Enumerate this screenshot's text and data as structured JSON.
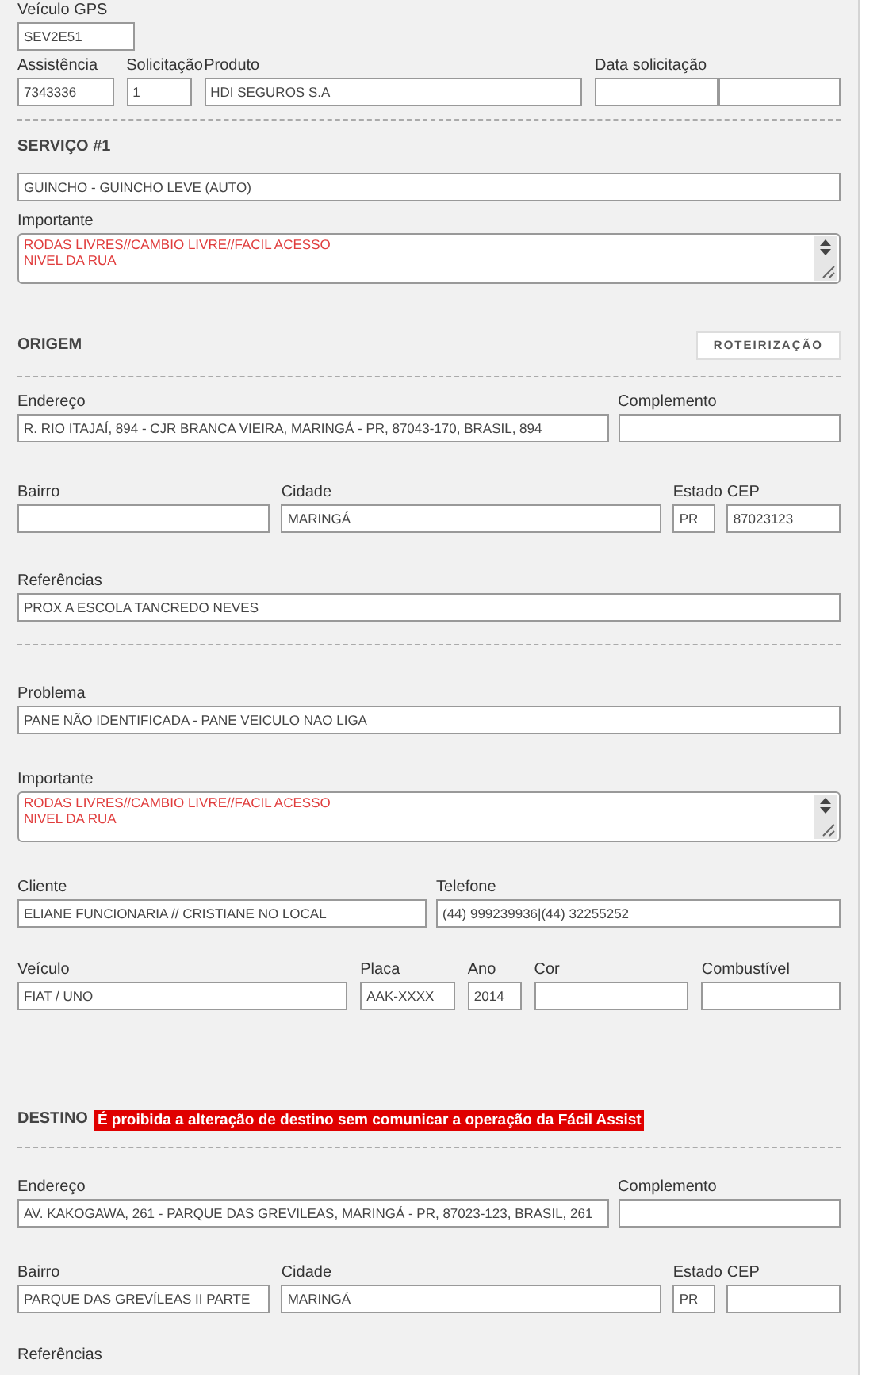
{
  "vehicle_gps": {
    "label": "Veículo GPS",
    "value": "SEV2E51"
  },
  "request": [
    {
      "label": "Assistência",
      "value": "7343336"
    },
    {
      "label": "Solicitação",
      "value": "1"
    },
    {
      "label": "Produto",
      "value": "HDI SEGUROS S.A"
    },
    {
      "label": "Data solicitação"
    }
  ],
  "service": {
    "title": "SERVIÇO #1",
    "value": "GUINCHO - GUINCHO LEVE (AUTO)",
    "important": {
      "label": "Importante",
      "value": "RODAS LIVRES//CAMBIO LIVRE//FACIL ACESSO\nNIVEL DA RUA"
    }
  },
  "origin": {
    "title": "ORIGEM",
    "button": "ROTEIRIZAÇÃO",
    "address": [
      {
        "label": "Endereço",
        "value": "R. RIO ITAJAÍ, 894 - CJR BRANCA VIEIRA, MARINGÁ - PR, 87043-170, BRASIL, 894"
      },
      {
        "label": "Complemento"
      }
    ],
    "district": [
      {
        "label": "Bairro"
      },
      {
        "label": "Cidade",
        "value": "MARINGÁ"
      },
      {
        "label": "Estado",
        "value": "PR"
      },
      {
        "label": "CEP",
        "value": "87023123"
      }
    ],
    "references": {
      "label": "Referências",
      "value": "PROX A ESCOLA TANCREDO NEVES"
    }
  },
  "problem": {
    "label": "Problema",
    "value": "PANE NÃO IDENTIFICADA - PANE VEICULO NAO LIGA"
  },
  "important": {
    "label": "Importante",
    "value": "RODAS LIVRES//CAMBIO LIVRE//FACIL ACESSO\nNIVEL DA RUA"
  },
  "client": [
    {
      "label": "Cliente",
      "value": "ELIANE FUNCIONARIA // CRISTIANE NO LOCAL"
    },
    {
      "label": "Telefone",
      "value": "(44) 999239936|(44) 32255252"
    }
  ],
  "vehicle": [
    {
      "label": "Veículo",
      "value": "FIAT / UNO"
    },
    {
      "label": "Placa",
      "value": "AAK-XXXX"
    },
    {
      "label": "Ano",
      "value": "2014"
    },
    {
      "label": "Cor"
    },
    {
      "label": "Combustível"
    }
  ],
  "destination": {
    "title": "DESTINO",
    "warning": "É proibida a alteração de destino sem comunicar a operação da Fácil Assist",
    "address": [
      {
        "label": "Endereço",
        "value": "AV. KAKOGAWA, 261 - PARQUE DAS GREVILEAS, MARINGÁ - PR, 87023-123, BRASIL, 261"
      },
      {
        "label": "Complemento"
      }
    ],
    "district": [
      {
        "label": "Bairro",
        "value": "PARQUE DAS GREVÍLEAS II PARTE"
      },
      {
        "label": "Cidade",
        "value": "MARINGÁ"
      },
      {
        "label": "Estado",
        "value": "PR"
      },
      {
        "label": "CEP"
      }
    ],
    "references": {
      "label": "Referências"
    }
  }
}
